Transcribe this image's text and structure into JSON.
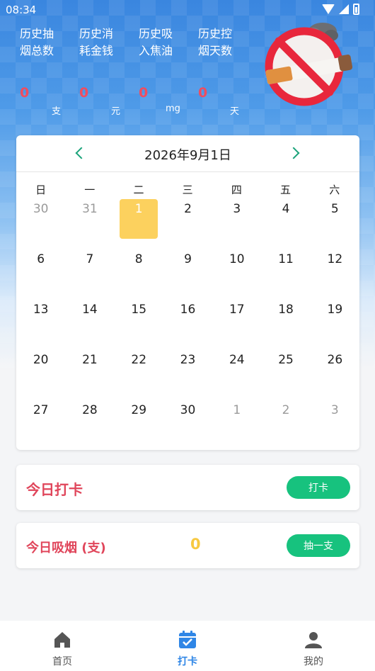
{
  "status_bar": {
    "time": "08:34"
  },
  "stats": [
    {
      "label": "历史抽烟总数",
      "value": "0",
      "unit": "支"
    },
    {
      "label": "历史消耗金钱",
      "value": "0",
      "unit": "元"
    },
    {
      "label": "历史吸入焦油",
      "value": "0",
      "unit": "mg"
    },
    {
      "label": "历史控烟天数",
      "value": "0",
      "unit": "天"
    }
  ],
  "calendar": {
    "title": "2026年9月1日",
    "weekdays": [
      "日",
      "一",
      "二",
      "三",
      "四",
      "五",
      "六"
    ],
    "weeks": [
      [
        {
          "d": "30",
          "m": true
        },
        {
          "d": "31",
          "m": true
        },
        {
          "d": "1",
          "s": true
        },
        {
          "d": "2"
        },
        {
          "d": "3"
        },
        {
          "d": "4"
        },
        {
          "d": "5"
        }
      ],
      [
        {
          "d": "6"
        },
        {
          "d": "7"
        },
        {
          "d": "8"
        },
        {
          "d": "9"
        },
        {
          "d": "10"
        },
        {
          "d": "11"
        },
        {
          "d": "12"
        }
      ],
      [
        {
          "d": "13"
        },
        {
          "d": "14"
        },
        {
          "d": "15"
        },
        {
          "d": "16"
        },
        {
          "d": "17"
        },
        {
          "d": "18"
        },
        {
          "d": "19"
        }
      ],
      [
        {
          "d": "20"
        },
        {
          "d": "21"
        },
        {
          "d": "22"
        },
        {
          "d": "23"
        },
        {
          "d": "24"
        },
        {
          "d": "25"
        },
        {
          "d": "26"
        }
      ],
      [
        {
          "d": "27"
        },
        {
          "d": "28"
        },
        {
          "d": "29"
        },
        {
          "d": "30"
        },
        {
          "d": "1",
          "m": true
        },
        {
          "d": "2",
          "m": true
        },
        {
          "d": "3",
          "m": true
        }
      ]
    ]
  },
  "checkin": {
    "title": "今日打卡",
    "button": "打卡"
  },
  "smoke": {
    "title": "今日吸烟 (支)",
    "count": "0",
    "button": "抽一支"
  },
  "nav": [
    {
      "label": "首页",
      "icon": "home-icon"
    },
    {
      "label": "打卡",
      "icon": "calendar-check-icon",
      "active": true
    },
    {
      "label": "我的",
      "icon": "user-icon"
    }
  ],
  "colors": {
    "accent_green": "#17c27e",
    "title_red": "#e0465b",
    "selected_day": "#fcd15e",
    "nav_active": "#2f86e6"
  }
}
